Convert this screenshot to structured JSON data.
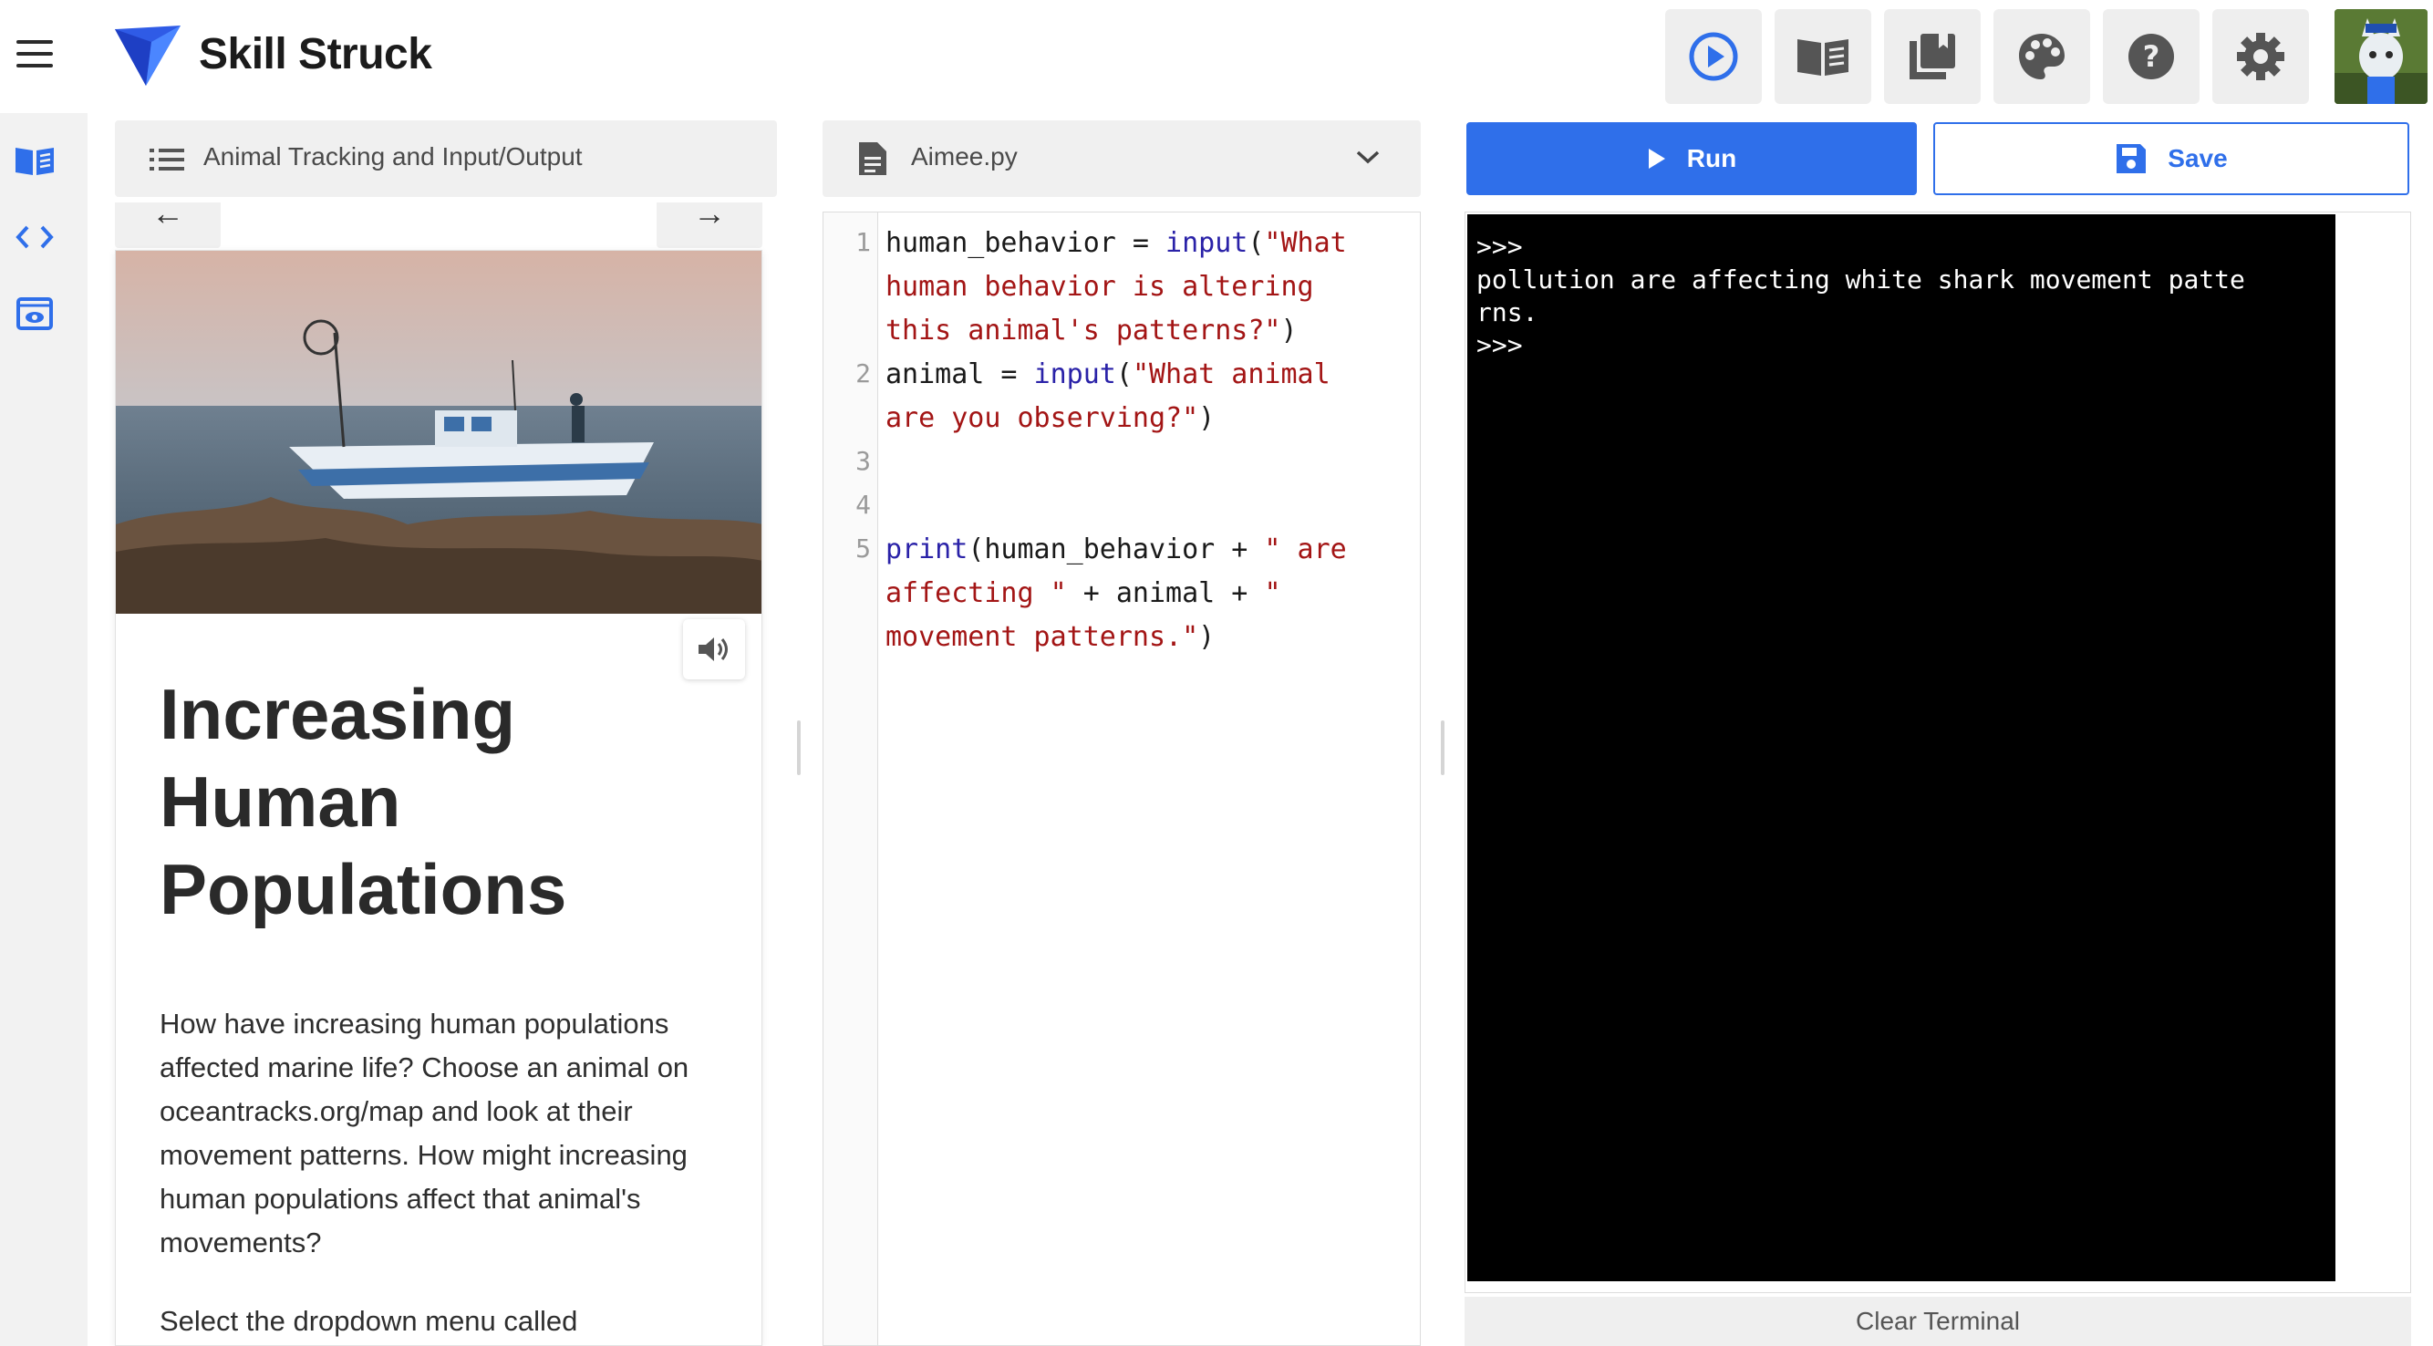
{
  "header": {
    "brand": "Skill Struck",
    "colors": {
      "accent": "#2f6fea",
      "logo": "#2f5be6"
    },
    "tools": [
      {
        "name": "run-preview",
        "icon": "play-circle-icon"
      },
      {
        "name": "lessons",
        "icon": "book-open-icon"
      },
      {
        "name": "library",
        "icon": "bookmarks-icon"
      },
      {
        "name": "theme",
        "icon": "palette-icon"
      },
      {
        "name": "help",
        "icon": "help-icon"
      },
      {
        "name": "settings",
        "icon": "gear-icon"
      }
    ]
  },
  "rail": {
    "icons": [
      "lesson-book-icon",
      "code-brackets-icon",
      "preview-icon"
    ]
  },
  "lesson": {
    "title": "Animal Tracking and Input/Output",
    "prev_arrow": "←",
    "next_arrow": "→",
    "heading": "Increasing Human Populations",
    "body": "How have increasing human populations affected marine life? Choose an animal on oceantracks.org/map and look at their movement patterns. How might increasing human populations affect that animal's movements?",
    "body2": "Select the dropdown menu called"
  },
  "editor": {
    "file_name": "Aimee.py",
    "line_numbers": [
      "1",
      "2",
      "3",
      "4",
      "5"
    ],
    "lines": [
      {
        "no": "1",
        "code": "human_behavior = input(\"What human behavior is altering this animal's patterns?\")"
      },
      {
        "no": "2",
        "code": "animal = input(\"What animal are you observing?\")"
      },
      {
        "no": "3",
        "code": ""
      },
      {
        "no": "4",
        "code": ""
      },
      {
        "no": "5",
        "code": "print(human_behavior + \" are affecting \" + animal + \" movement patterns.\")"
      }
    ]
  },
  "actions": {
    "run_label": "Run",
    "save_label": "Save"
  },
  "terminal": {
    "output": ">>>\npollution are affecting white shark movement patte\nrns.\n>>>",
    "clear_label": "Clear Terminal"
  }
}
